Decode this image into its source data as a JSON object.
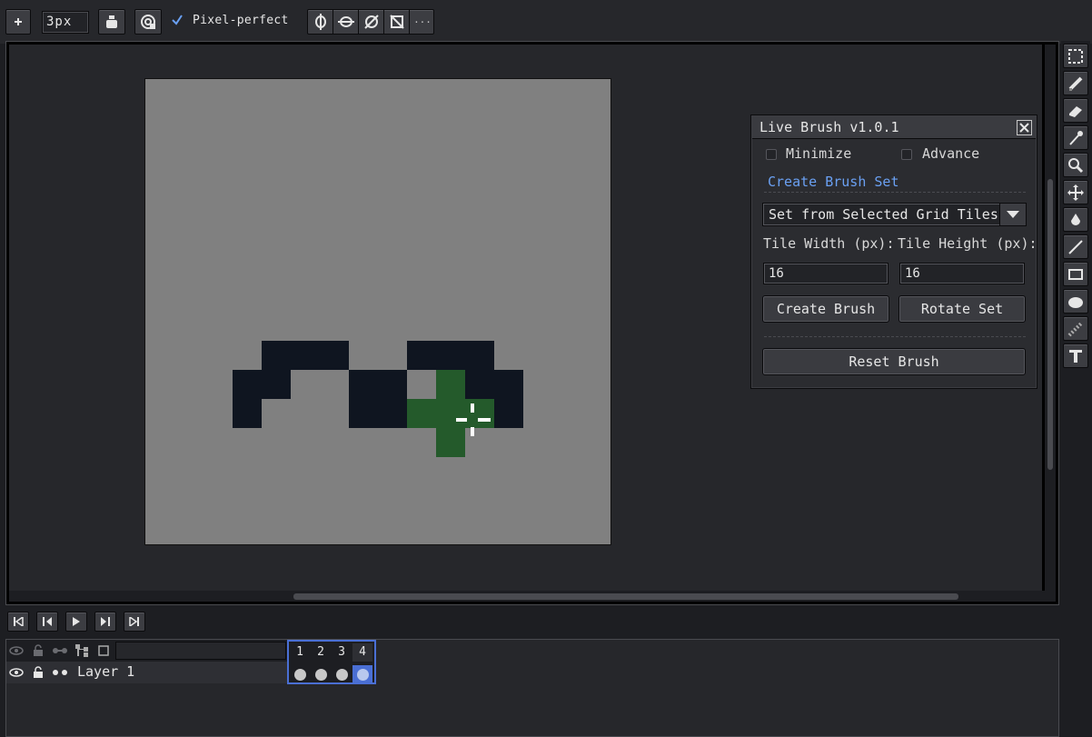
{
  "toolbar": {
    "brush_size": "3px",
    "pixel_perfect_label": "Pixel-perfect",
    "pixel_perfect_checked": true,
    "more_label": "···"
  },
  "dialog": {
    "title": "Live Brush v1.0.1",
    "minimize_label": "Minimize",
    "advance_label": "Advance",
    "section_label": "Create Brush Set",
    "mode_selected": "Set from Selected Grid Tiles",
    "tile_width_label": "Tile Width (px):",
    "tile_height_label": "Tile Height (px):",
    "tile_width_value": "16",
    "tile_height_value": "16",
    "create_brush_label": "Create Brush",
    "rotate_set_label": "Rotate Set",
    "reset_brush_label": "Reset Brush"
  },
  "timeline": {
    "layers": [
      {
        "name": "Layer 1"
      }
    ],
    "frames": [
      "1",
      "2",
      "3",
      "4"
    ],
    "active_frame": "4"
  },
  "colors": {
    "canvas_bg": "#808080",
    "dark_pixel": "#0f1520",
    "green_pixel": "#245a2b",
    "accent": "#4a6fd4",
    "link": "#6aa0f2"
  },
  "icons": {
    "tools": [
      "marquee-icon",
      "pencil-icon",
      "eraser-icon",
      "eyedropper-icon",
      "zoom-icon",
      "move-icon",
      "fill-icon",
      "line-icon",
      "rectangle-icon",
      "ellipse-icon",
      "contour-icon",
      "text-icon"
    ]
  }
}
